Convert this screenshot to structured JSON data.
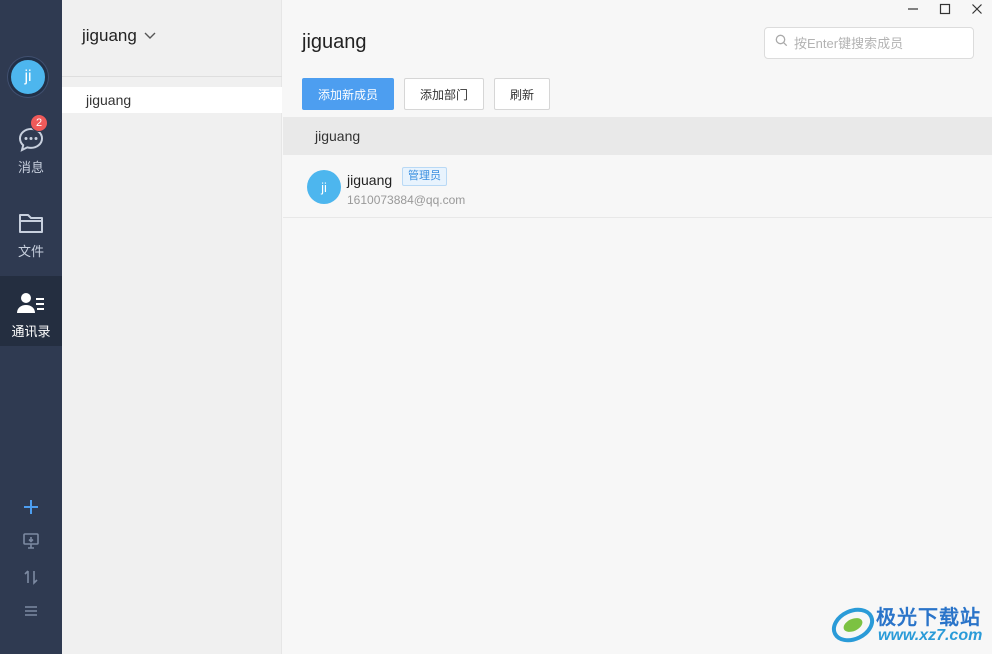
{
  "window": {
    "minimize_label": "minimize",
    "maximize_label": "maximize",
    "close_label": "close"
  },
  "rail": {
    "avatar_text": "ji",
    "items": [
      {
        "label": "消息",
        "icon": "chat-bubble-icon",
        "badge": "2"
      },
      {
        "label": "文件",
        "icon": "folder-icon"
      },
      {
        "label": "通讯录",
        "icon": "contacts-icon",
        "active": true
      }
    ],
    "bottom_icons": [
      "plus-icon",
      "monitor-download-icon",
      "sort-icon",
      "menu-icon"
    ]
  },
  "sidebar": {
    "org_name": "jiguang",
    "departments": [
      {
        "label": "jiguang",
        "selected": true
      }
    ]
  },
  "main": {
    "title": "jiguang",
    "search": {
      "placeholder": "按Enter键搜索成员",
      "value": ""
    },
    "buttons": {
      "add_member": "添加新成员",
      "add_department": "添加部门",
      "refresh": "刷新"
    },
    "section_title": "jiguang",
    "members": [
      {
        "avatar_text": "ji",
        "name": "jiguang",
        "role_tag": "管理员",
        "email": "1610073884@qq.com"
      }
    ]
  },
  "watermark": {
    "title": "极光下载站",
    "url": "www.xz7.com"
  },
  "colors": {
    "rail_bg": "#2f3a51",
    "accent": "#4d9ef0",
    "avatar": "#4db6ee",
    "badge": "#f05a5a"
  }
}
